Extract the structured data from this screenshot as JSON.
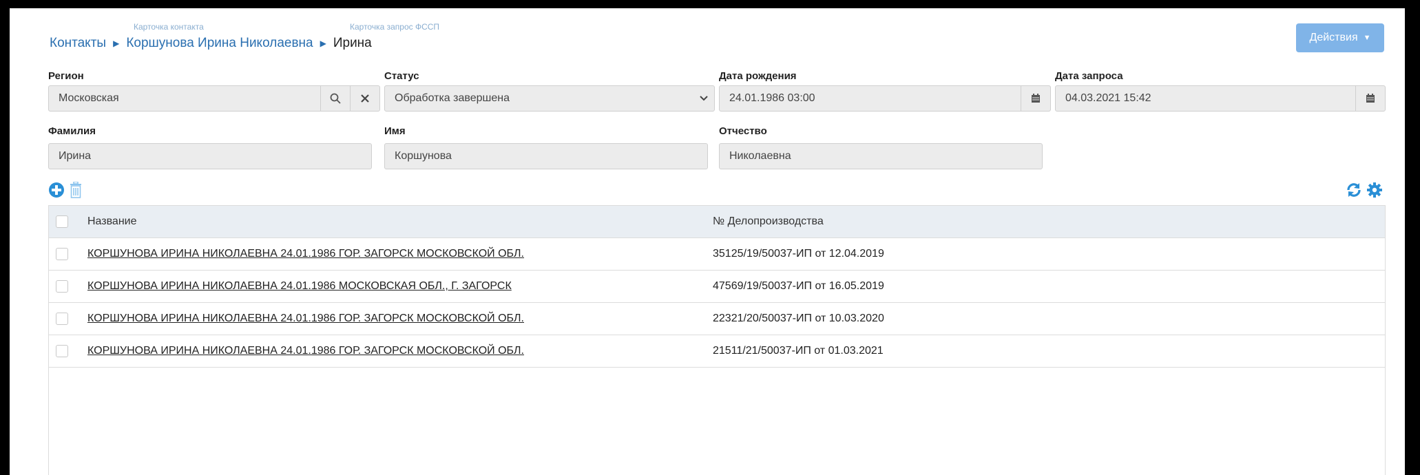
{
  "breadcrumb": {
    "hint_contact": "Карточка контакта",
    "hint_fssp": "Карточка запрос ФССП",
    "items": [
      "Контакты",
      "Коршунова Ирина Николаевна"
    ],
    "current": "Ирина"
  },
  "actions_button": "Действия",
  "form": {
    "region": {
      "label": "Регион",
      "value": "Московская"
    },
    "status": {
      "label": "Статус",
      "value": "Обработка завершена"
    },
    "birth_date": {
      "label": "Дата рождения",
      "value": "24.01.1986 03:00"
    },
    "request_date": {
      "label": "Дата запроса",
      "value": "04.03.2021 15:42"
    },
    "last_name": {
      "label": "Фамилия",
      "value": "Ирина"
    },
    "first_name": {
      "label": "Имя",
      "value": "Коршунова"
    },
    "patronymic": {
      "label": "Отчество",
      "value": "Николаевна"
    }
  },
  "icons": {
    "add": "plus-circle-icon",
    "delete": "trash-icon",
    "refresh": "refresh-icon",
    "settings": "gear-icon"
  },
  "colors": {
    "accent": "#2a8fd6",
    "button": "#80b4e8",
    "link": "#2a6fb0"
  },
  "table": {
    "columns": [
      "Название",
      "№ Делопроизводства"
    ],
    "rows": [
      {
        "name": "КОРШУНОВА ИРИНА НИКОЛАЕВНА 24.01.1986 ГОР. ЗАГОРСК МОСКОВСКОЙ ОБЛ.",
        "number": "35125/19/50037-ИП от 12.04.2019"
      },
      {
        "name": "КОРШУНОВА ИРИНА НИКОЛАЕВНА 24.01.1986 МОСКОВСКАЯ ОБЛ., Г. ЗАГОРСК",
        "number": "47569/19/50037-ИП от 16.05.2019"
      },
      {
        "name": "КОРШУНОВА ИРИНА НИКОЛАЕВНА 24.01.1986 ГОР. ЗАГОРСК МОСКОВСКОЙ ОБЛ.",
        "number": "22321/20/50037-ИП от 10.03.2020"
      },
      {
        "name": "КОРШУНОВА ИРИНА НИКОЛАЕВНА 24.01.1986 ГОР. ЗАГОРСК МОСКОВСКОЙ ОБЛ.",
        "number": "21511/21/50037-ИП от 01.03.2021"
      }
    ]
  }
}
